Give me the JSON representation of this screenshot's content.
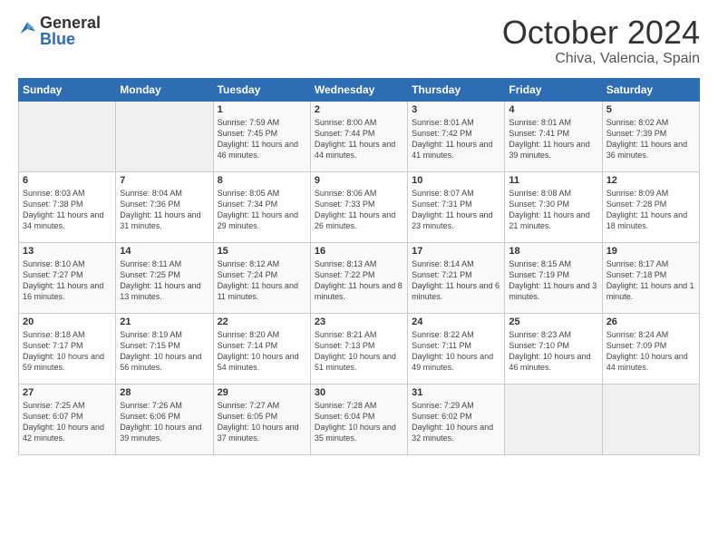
{
  "header": {
    "logo_general": "General",
    "logo_blue": "Blue",
    "month": "October 2024",
    "location": "Chiva, Valencia, Spain"
  },
  "days_of_week": [
    "Sunday",
    "Monday",
    "Tuesday",
    "Wednesday",
    "Thursday",
    "Friday",
    "Saturday"
  ],
  "weeks": [
    [
      {
        "num": "",
        "detail": ""
      },
      {
        "num": "",
        "detail": ""
      },
      {
        "num": "1",
        "detail": "Sunrise: 7:59 AM\nSunset: 7:45 PM\nDaylight: 11 hours and 46 minutes."
      },
      {
        "num": "2",
        "detail": "Sunrise: 8:00 AM\nSunset: 7:44 PM\nDaylight: 11 hours and 44 minutes."
      },
      {
        "num": "3",
        "detail": "Sunrise: 8:01 AM\nSunset: 7:42 PM\nDaylight: 11 hours and 41 minutes."
      },
      {
        "num": "4",
        "detail": "Sunrise: 8:01 AM\nSunset: 7:41 PM\nDaylight: 11 hours and 39 minutes."
      },
      {
        "num": "5",
        "detail": "Sunrise: 8:02 AM\nSunset: 7:39 PM\nDaylight: 11 hours and 36 minutes."
      }
    ],
    [
      {
        "num": "6",
        "detail": "Sunrise: 8:03 AM\nSunset: 7:38 PM\nDaylight: 11 hours and 34 minutes."
      },
      {
        "num": "7",
        "detail": "Sunrise: 8:04 AM\nSunset: 7:36 PM\nDaylight: 11 hours and 31 minutes."
      },
      {
        "num": "8",
        "detail": "Sunrise: 8:05 AM\nSunset: 7:34 PM\nDaylight: 11 hours and 29 minutes."
      },
      {
        "num": "9",
        "detail": "Sunrise: 8:06 AM\nSunset: 7:33 PM\nDaylight: 11 hours and 26 minutes."
      },
      {
        "num": "10",
        "detail": "Sunrise: 8:07 AM\nSunset: 7:31 PM\nDaylight: 11 hours and 23 minutes."
      },
      {
        "num": "11",
        "detail": "Sunrise: 8:08 AM\nSunset: 7:30 PM\nDaylight: 11 hours and 21 minutes."
      },
      {
        "num": "12",
        "detail": "Sunrise: 8:09 AM\nSunset: 7:28 PM\nDaylight: 11 hours and 18 minutes."
      }
    ],
    [
      {
        "num": "13",
        "detail": "Sunrise: 8:10 AM\nSunset: 7:27 PM\nDaylight: 11 hours and 16 minutes."
      },
      {
        "num": "14",
        "detail": "Sunrise: 8:11 AM\nSunset: 7:25 PM\nDaylight: 11 hours and 13 minutes."
      },
      {
        "num": "15",
        "detail": "Sunrise: 8:12 AM\nSunset: 7:24 PM\nDaylight: 11 hours and 11 minutes."
      },
      {
        "num": "16",
        "detail": "Sunrise: 8:13 AM\nSunset: 7:22 PM\nDaylight: 11 hours and 8 minutes."
      },
      {
        "num": "17",
        "detail": "Sunrise: 8:14 AM\nSunset: 7:21 PM\nDaylight: 11 hours and 6 minutes."
      },
      {
        "num": "18",
        "detail": "Sunrise: 8:15 AM\nSunset: 7:19 PM\nDaylight: 11 hours and 3 minutes."
      },
      {
        "num": "19",
        "detail": "Sunrise: 8:17 AM\nSunset: 7:18 PM\nDaylight: 11 hours and 1 minute."
      }
    ],
    [
      {
        "num": "20",
        "detail": "Sunrise: 8:18 AM\nSunset: 7:17 PM\nDaylight: 10 hours and 59 minutes."
      },
      {
        "num": "21",
        "detail": "Sunrise: 8:19 AM\nSunset: 7:15 PM\nDaylight: 10 hours and 56 minutes."
      },
      {
        "num": "22",
        "detail": "Sunrise: 8:20 AM\nSunset: 7:14 PM\nDaylight: 10 hours and 54 minutes."
      },
      {
        "num": "23",
        "detail": "Sunrise: 8:21 AM\nSunset: 7:13 PM\nDaylight: 10 hours and 51 minutes."
      },
      {
        "num": "24",
        "detail": "Sunrise: 8:22 AM\nSunset: 7:11 PM\nDaylight: 10 hours and 49 minutes."
      },
      {
        "num": "25",
        "detail": "Sunrise: 8:23 AM\nSunset: 7:10 PM\nDaylight: 10 hours and 46 minutes."
      },
      {
        "num": "26",
        "detail": "Sunrise: 8:24 AM\nSunset: 7:09 PM\nDaylight: 10 hours and 44 minutes."
      }
    ],
    [
      {
        "num": "27",
        "detail": "Sunrise: 7:25 AM\nSunset: 6:07 PM\nDaylight: 10 hours and 42 minutes."
      },
      {
        "num": "28",
        "detail": "Sunrise: 7:26 AM\nSunset: 6:06 PM\nDaylight: 10 hours and 39 minutes."
      },
      {
        "num": "29",
        "detail": "Sunrise: 7:27 AM\nSunset: 6:05 PM\nDaylight: 10 hours and 37 minutes."
      },
      {
        "num": "30",
        "detail": "Sunrise: 7:28 AM\nSunset: 6:04 PM\nDaylight: 10 hours and 35 minutes."
      },
      {
        "num": "31",
        "detail": "Sunrise: 7:29 AM\nSunset: 6:02 PM\nDaylight: 10 hours and 32 minutes."
      },
      {
        "num": "",
        "detail": ""
      },
      {
        "num": "",
        "detail": ""
      }
    ]
  ]
}
